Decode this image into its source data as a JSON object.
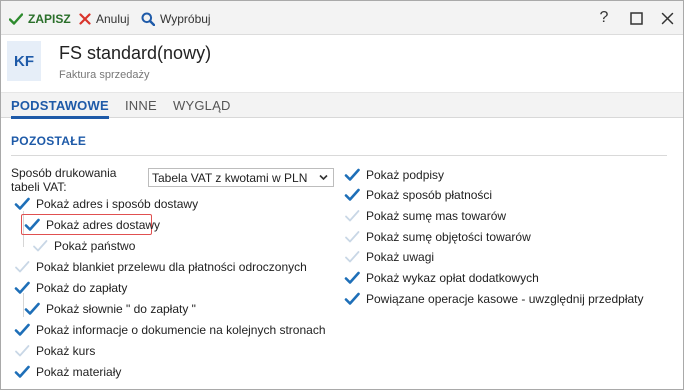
{
  "toolbar": {
    "save_label": "ZAPISZ",
    "cancel_label": "Anuluj",
    "try_label": "Wypróbuj",
    "help_label": "?"
  },
  "header": {
    "badge": "KF",
    "title": "FS standard(nowy)",
    "subtitle": "Faktura sprzedaży"
  },
  "tabs": [
    {
      "label": "PODSTAWOWE",
      "active": true
    },
    {
      "label": "INNE",
      "active": false
    },
    {
      "label": "WYGLĄD",
      "active": false
    }
  ],
  "section": {
    "title": "POZOSTAŁE"
  },
  "print_method": {
    "label": "Sposób drukowania tabeli VAT:",
    "value": "Tabela VAT z kwotami w PLN"
  },
  "left_options": [
    {
      "label": "Pokaż adres i sposób dostawy",
      "checked": true
    },
    {
      "label": "Pokaż adres dostawy",
      "checked": true
    },
    {
      "label": "Pokaż państwo",
      "checked": false
    },
    {
      "label": "Pokaż blankiet przelewu dla płatności odroczonych",
      "checked": false
    },
    {
      "label": "Pokaż do zapłaty",
      "checked": true
    },
    {
      "label": "Pokaż słownie \" do zapłaty \"",
      "checked": true
    },
    {
      "label": "Pokaż informacje o dokumencie na kolejnych stronach",
      "checked": true
    },
    {
      "label": "Pokaż kurs",
      "checked": false
    },
    {
      "label": "Pokaż materiały",
      "checked": true
    }
  ],
  "right_options": [
    {
      "label": "Pokaż podpisy",
      "checked": true
    },
    {
      "label": "Pokaż sposób płatności",
      "checked": true
    },
    {
      "label": "Pokaż sumę mas towarów",
      "checked": false
    },
    {
      "label": "Pokaż sumę objętości towarów",
      "checked": false
    },
    {
      "label": "Pokaż uwagi",
      "checked": false
    },
    {
      "label": "Pokaż wykaz opłat dodatkowych",
      "checked": true
    },
    {
      "label": "Powiązane operacje kasowe - uwzględnij przedpłaty",
      "checked": true
    }
  ],
  "colors": {
    "accent": "#1e5aa8",
    "check_on": "#1e6fb8",
    "check_off": "#c9d7e6",
    "highlight": "#e05050"
  }
}
